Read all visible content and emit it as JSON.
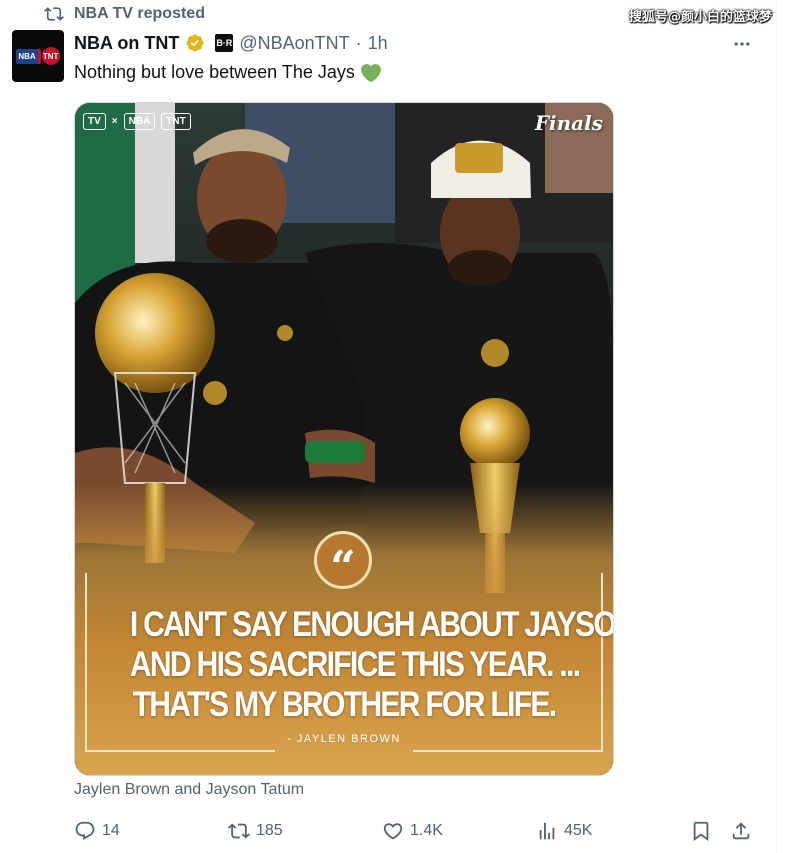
{
  "repost": {
    "label": "NBA TV reposted",
    "icon": "repost-icon"
  },
  "watermark": "搜狐号@颜小白的篮球梦",
  "author": {
    "avatar_nba": "NBA",
    "avatar_tnt": "TNT",
    "display_name": "NBA on TNT",
    "verified_icon": "verified-gold-icon",
    "affiliate_badge": "B·R",
    "handle": "@NBAonTNT",
    "separator": "·",
    "timestamp": "1h"
  },
  "tweet": {
    "text": "Nothing but love between The Jays",
    "emoji": "green-heart-icon",
    "media_alt_caption": "Jaylen Brown and Jayson Tatum"
  },
  "media": {
    "top_left_logos": [
      "TV",
      "×",
      "NBA",
      "TNT"
    ],
    "top_right_logo": "Finals",
    "quote_mark": "“",
    "quote_lines": [
      "I CAN'T SAY ENOUGH ABOUT JAYSON TATUM",
      "AND HIS SACRIFICE THIS YEAR. ...",
      "THAT'S MY BROTHER FOR LIFE."
    ],
    "attribution": "- JAYLEN BROWN"
  },
  "actions": {
    "reply_count": "14",
    "repost_count": "185",
    "like_count": "1.4K",
    "views_count": "45K"
  },
  "colors": {
    "text_primary": "#0f1419",
    "text_secondary": "#536471",
    "verified_gold": "#e2b719",
    "heart_green": "#78b159",
    "gold_overlay": "#c8923f"
  }
}
